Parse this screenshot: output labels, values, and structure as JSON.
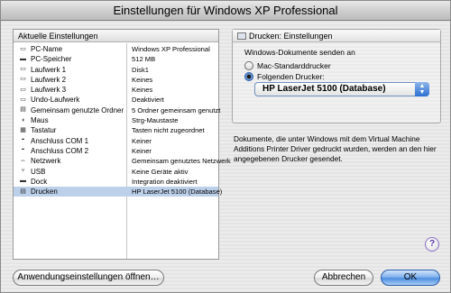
{
  "window": {
    "title": "Einstellungen für Windows XP Professional"
  },
  "settings_list": {
    "header": "Aktuelle Einstellungen",
    "rows": [
      {
        "icon": "pc-icon",
        "name": "PC-Name",
        "value": "Windows XP Professional"
      },
      {
        "icon": "memory-icon",
        "name": "PC-Speicher",
        "value": "512 MB"
      },
      {
        "icon": "drive-icon",
        "name": "Laufwerk 1",
        "value": "Disk1"
      },
      {
        "icon": "drive-icon",
        "name": "Laufwerk 2",
        "value": "Keines"
      },
      {
        "icon": "drive-icon",
        "name": "Laufwerk 3",
        "value": "Keines"
      },
      {
        "icon": "undo-drive-icon",
        "name": "Undo-Laufwerk",
        "value": "Deaktiviert"
      },
      {
        "icon": "shared-folder-icon",
        "name": "Gemeinsam genutzte Ordner",
        "value": "5 Ordner gemeinsam genutzt"
      },
      {
        "icon": "mouse-icon",
        "name": "Maus",
        "value": "Strg-Maustaste"
      },
      {
        "icon": "keyboard-icon",
        "name": "Tastatur",
        "value": "Tasten nicht zugeordnet"
      },
      {
        "icon": "com-port-icon",
        "name": "Anschluss COM 1",
        "value": "Keiner"
      },
      {
        "icon": "com-port-icon",
        "name": "Anschluss COM 2",
        "value": "Keiner"
      },
      {
        "icon": "network-icon",
        "name": "Netzwerk",
        "value": "Gemeinsam genutztes Netzwerk"
      },
      {
        "icon": "usb-icon",
        "name": "USB",
        "value": "Keine Geräte aktiv"
      },
      {
        "icon": "dock-icon",
        "name": "Dock",
        "value": "Integration deaktiviert"
      },
      {
        "icon": "printer-icon",
        "name": "Drucken",
        "value": "HP LaserJet 5100 (Database)",
        "selected": true
      }
    ]
  },
  "printer_panel": {
    "title": "Drucken: Einstellungen",
    "send_label": "Windows-Dokumente senden an",
    "option_default": "Mac-Standarddrucker",
    "option_following": "Folgenden Drucker:",
    "selected_option": "option_following",
    "printer_select": "HP LaserJet 5100 (Database)"
  },
  "description": "Dokumente, die unter Windows mit dem Virtual Machine Additions Printer Driver gedruckt wurden, werden an den hier angegebenen Drucker gesendet.",
  "help": {
    "label": "?"
  },
  "buttons": {
    "open_app_settings": "Anwendungseinstellungen öffnen…",
    "cancel": "Abbrechen",
    "ok": "OK"
  }
}
